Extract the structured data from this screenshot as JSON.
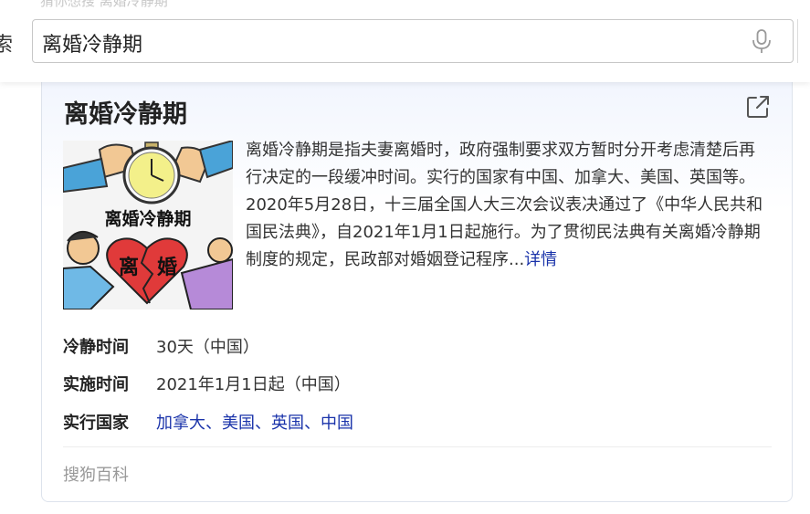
{
  "header": {
    "top_cut_text": "猜你想搜 离婚冷静期",
    "left_cut_text": "索",
    "search": {
      "value": "离婚冷静期",
      "icon": "microphone-icon"
    }
  },
  "card": {
    "title": "离婚冷静期",
    "share_icon": "external-link-icon",
    "image_alt": "离婚冷静期",
    "image_words": [
      "离婚冷静期",
      "离",
      "婚"
    ],
    "summary": "离婚冷静期是指夫妻离婚时，政府强制要求双方暂时分开考虑清楚后再行决定的一段缓冲时间。实行的国家有中国、加拿大、美国、英国等。2020年5月28日，十三届全国人大三次会议表决通过了《中华人民共和国民法典》，自2021年1月1日起施行。为了贯彻民法典有关离婚冷静期制度的规定，民政部对婚姻登记程序...",
    "detail_link": "详情",
    "attributes": [
      {
        "label": "冷静时间",
        "value": "30天（中国）"
      },
      {
        "label": "实施时间",
        "value": "2021年1月1日起（中国）"
      },
      {
        "label": "实行国家",
        "links": [
          "加拿大",
          "美国",
          "英国",
          "中国"
        ],
        "separator": "、"
      }
    ],
    "source": "搜狗百科",
    "colors": {
      "link": "#1a33aa",
      "card_gradient_top": "#f1f5fe",
      "border": "#dde3ec"
    }
  }
}
